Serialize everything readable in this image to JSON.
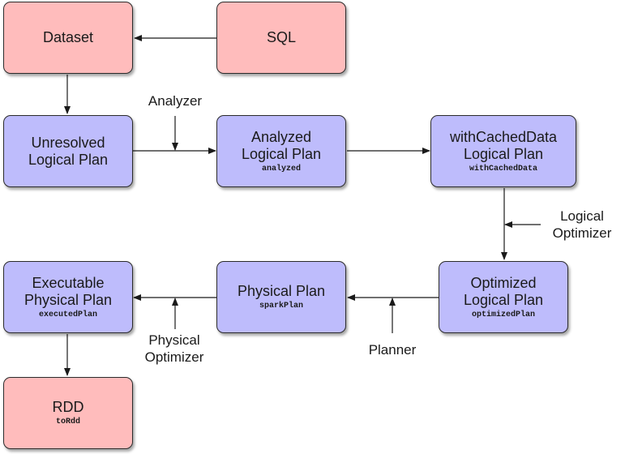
{
  "diagram": {
    "colors": {
      "source_node": "#ffbcbc",
      "plan_node": "#bebcfc",
      "edge": "#1a1a1a"
    },
    "nodes": {
      "dataset": {
        "title": "Dataset",
        "code": ""
      },
      "sql": {
        "title": "SQL",
        "code": ""
      },
      "unresolved": {
        "title": "Unresolved\nLogical Plan",
        "code": ""
      },
      "analyzed": {
        "title": "Analyzed\nLogical Plan",
        "code": "analyzed"
      },
      "cached": {
        "title": "withCachedData\nLogical Plan",
        "code": "withCachedData"
      },
      "optimized": {
        "title": "Optimized\nLogical Plan",
        "code": "optimizedPlan"
      },
      "physical": {
        "title": "Physical Plan",
        "code": "sparkPlan"
      },
      "executable": {
        "title": "Executable\nPhysical Plan",
        "code": "executedPlan"
      },
      "rdd": {
        "title": "RDD",
        "code": "toRdd"
      }
    },
    "edge_labels": {
      "analyzer": "Analyzer",
      "logical_optimizer": "Logical\nOptimizer",
      "planner": "Planner",
      "physical_optimizer": "Physical\nOptimizer"
    },
    "edges": [
      {
        "from": "sql",
        "to": "dataset"
      },
      {
        "from": "dataset",
        "to": "unresolved"
      },
      {
        "from": "unresolved",
        "to": "analyzed",
        "via": "analyzer"
      },
      {
        "from": "analyzed",
        "to": "cached"
      },
      {
        "from": "cached",
        "to": "optimized",
        "via": "logical_optimizer"
      },
      {
        "from": "optimized",
        "to": "physical",
        "via": "planner"
      },
      {
        "from": "physical",
        "to": "executable",
        "via": "physical_optimizer"
      },
      {
        "from": "executable",
        "to": "rdd"
      }
    ]
  }
}
